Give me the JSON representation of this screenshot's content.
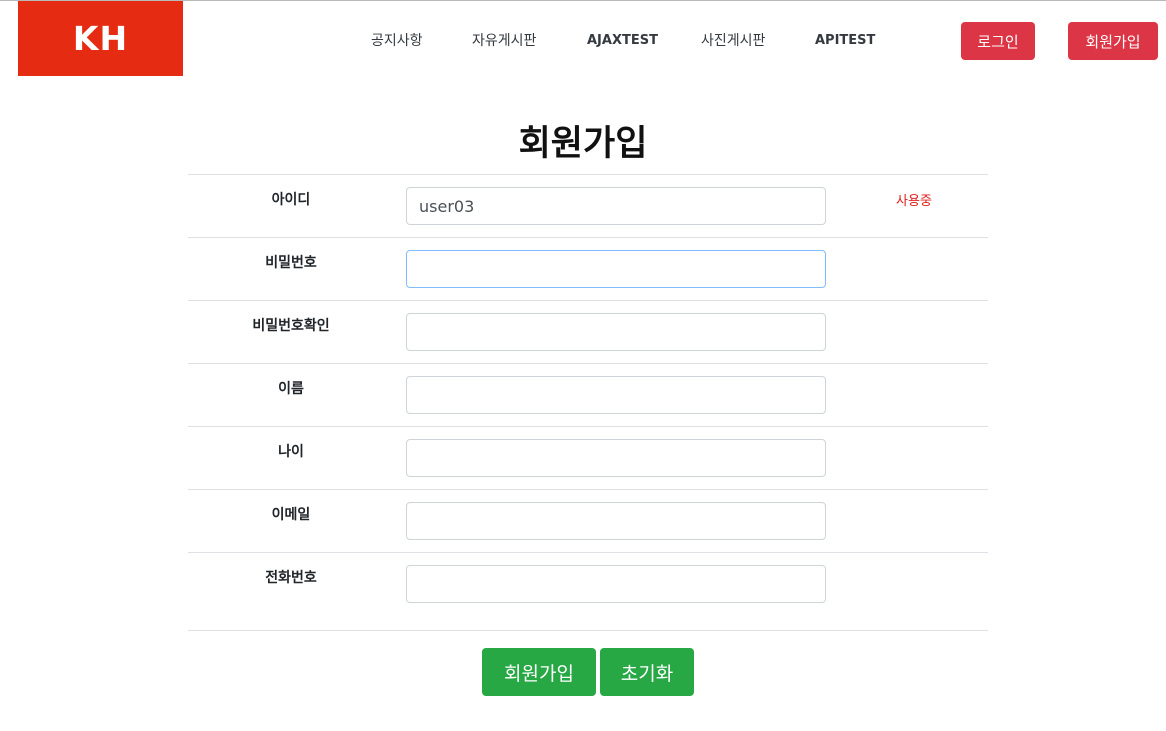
{
  "header": {
    "logo_text": "KH",
    "nav": [
      {
        "label": "공지사항"
      },
      {
        "label": "자유게시판"
      },
      {
        "label": "AJAXTEST"
      },
      {
        "label": "사진게시판"
      },
      {
        "label": "APITEST"
      }
    ],
    "login_label": "로그인",
    "signup_label": "회원가입"
  },
  "page": {
    "title": "회원가입"
  },
  "form": {
    "fields": [
      {
        "label": "아이디",
        "value": "user03",
        "status": "사용중"
      },
      {
        "label": "비밀번호",
        "value": ""
      },
      {
        "label": "비밀번호확인",
        "value": ""
      },
      {
        "label": "이름",
        "value": ""
      },
      {
        "label": "나이",
        "value": ""
      },
      {
        "label": "이메일",
        "value": ""
      },
      {
        "label": "전화번호",
        "value": ""
      }
    ],
    "submit_label": "회원가입",
    "reset_label": "초기화"
  },
  "colors": {
    "logo": "#e52b12",
    "header_button": "#dc3545",
    "form_button": "#28a745",
    "status_text": "#e0201d"
  }
}
